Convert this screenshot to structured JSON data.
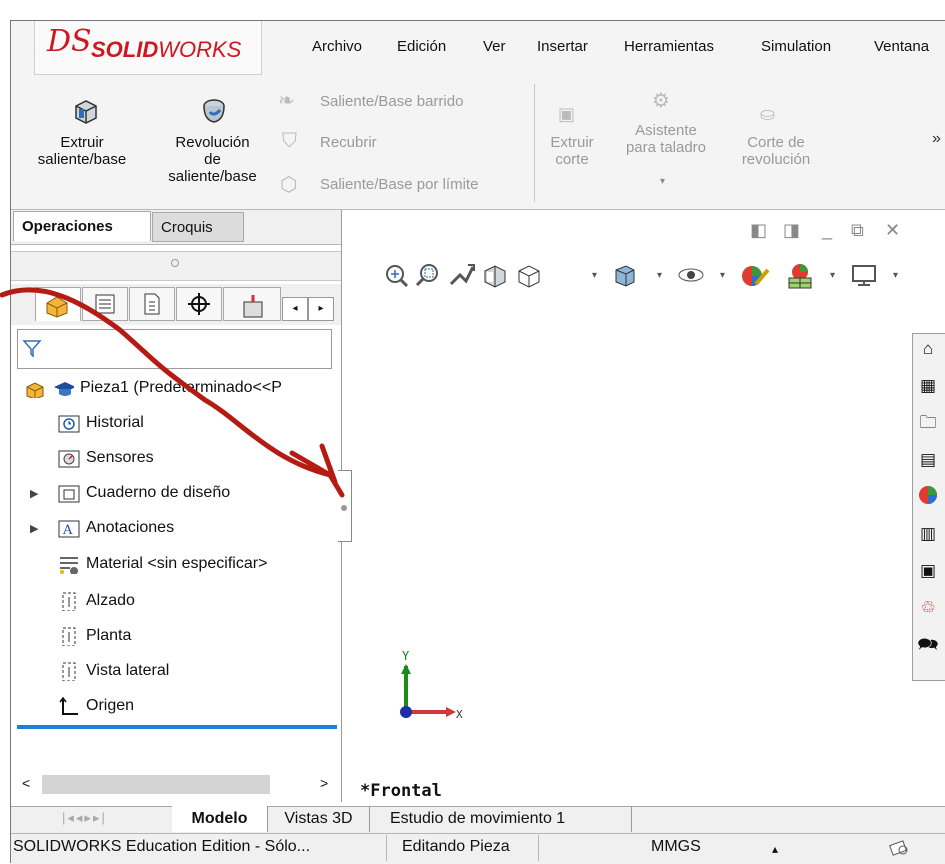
{
  "app": {
    "logo_ds": "DS",
    "logo_bold": "SOLID",
    "logo_light": "WORKS",
    "brand_color": "#d0161e"
  },
  "menu": [
    "Archivo",
    "Edición",
    "Ver",
    "Insertar",
    "Herramientas",
    "Simulation",
    "Ventana"
  ],
  "ribbon": {
    "extruir_saliente": [
      "Extruir",
      "saliente/base"
    ],
    "revolucion": [
      "Revolución",
      "de",
      "saliente/base"
    ],
    "barrido": "Saliente/Base barrido",
    "recubrir": "Recubrir",
    "por_limite": "Saliente/Base por límite",
    "extruir_corte": [
      "Extruir",
      "corte"
    ],
    "asistente": [
      "Asistente",
      "para taladro"
    ],
    "corte_revolucion": [
      "Corte de",
      "revolución"
    ],
    "more": "»"
  },
  "panel": {
    "tab_operaciones": "Operaciones",
    "tab_croquis": "Croquis",
    "tree": [
      {
        "label": "Pieza1  (Predeterminado<<P",
        "icon": "part-icon"
      },
      {
        "label": "Historial",
        "icon": "history-icon"
      },
      {
        "label": "Sensores",
        "icon": "sensor-icon"
      },
      {
        "label": "Cuaderno de diseño",
        "icon": "design-binder-icon",
        "expandable": true
      },
      {
        "label": "Anotaciones",
        "icon": "annotations-icon",
        "expandable": true
      },
      {
        "label": "Material <sin especificar>",
        "icon": "material-icon"
      },
      {
        "label": "Alzado",
        "icon": "plane-icon"
      },
      {
        "label": "Planta",
        "icon": "plane-icon"
      },
      {
        "label": "Vista lateral",
        "icon": "plane-icon"
      },
      {
        "label": "Origen",
        "icon": "origin-icon"
      }
    ]
  },
  "graphics": {
    "view_label": "*Frontal",
    "axis_y": "Y",
    "axis_x": "X"
  },
  "bottom_tabs": [
    "Modelo",
    "Vistas 3D",
    "Estudio de movimiento 1"
  ],
  "status": {
    "edition": "SOLIDWORKS Education Edition - Sólo...",
    "mode": "Editando Pieza",
    "units": "MMGS",
    "arrow": "▴"
  }
}
